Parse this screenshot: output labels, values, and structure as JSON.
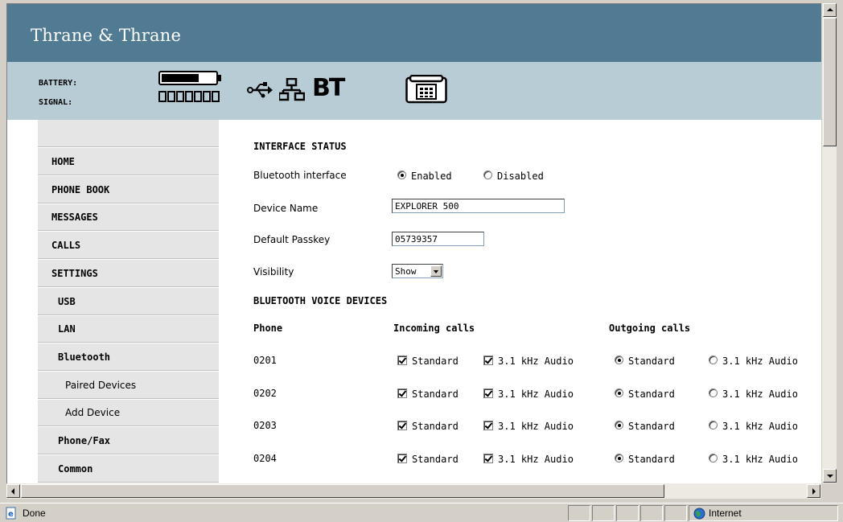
{
  "brand": {
    "name": "Thrane & Thrane"
  },
  "status": {
    "battery_label": "BATTERY:",
    "signal_label": "SIGNAL:",
    "battery_level": 0.7,
    "signal_bars": 7,
    "bt_icon_text": "BT",
    "icons": [
      "usb-icon",
      "lan-icon",
      "bluetooth-icon",
      "phone-icon"
    ]
  },
  "sidebar": {
    "items": [
      {
        "label": "HOME",
        "level": 0
      },
      {
        "label": "PHONE BOOK",
        "level": 0
      },
      {
        "label": "MESSAGES",
        "level": 0
      },
      {
        "label": "CALLS",
        "level": 0
      },
      {
        "label": "SETTINGS",
        "level": 0
      },
      {
        "label": "USB",
        "level": 1
      },
      {
        "label": "LAN",
        "level": 1
      },
      {
        "label": "Bluetooth",
        "level": 1
      },
      {
        "label": "Paired Devices",
        "level": 2
      },
      {
        "label": "Add Device",
        "level": 2
      },
      {
        "label": "Phone/Fax",
        "level": 1
      },
      {
        "label": "Common",
        "level": 1
      }
    ]
  },
  "interface_status": {
    "heading": "INTERFACE STATUS",
    "bt_label": "Bluetooth interface",
    "enabled_label": "Enabled",
    "disabled_label": "Disabled",
    "enabled": true,
    "device_name_label": "Device Name",
    "device_name_value": "EXPLORER 500",
    "passkey_label": "Default Passkey",
    "passkey_value": "05739357",
    "visibility_label": "Visibility",
    "visibility_value": "Show"
  },
  "voice_devices": {
    "heading": "BLUETOOTH VOICE DEVICES",
    "col_phone": "Phone",
    "col_incoming": "Incoming calls",
    "col_outgoing": "Outgoing calls",
    "opt_standard": "Standard",
    "opt_audio": "3.1 kHz Audio",
    "rows": [
      {
        "phone": "0201",
        "in_standard": true,
        "in_audio": true,
        "out": "standard"
      },
      {
        "phone": "0202",
        "in_standard": true,
        "in_audio": true,
        "out": "standard"
      },
      {
        "phone": "0203",
        "in_standard": true,
        "in_audio": true,
        "out": "standard"
      },
      {
        "phone": "0204",
        "in_standard": true,
        "in_audio": true,
        "out": "standard"
      }
    ]
  },
  "browser": {
    "status_text": "Done",
    "zone_text": "Internet"
  }
}
